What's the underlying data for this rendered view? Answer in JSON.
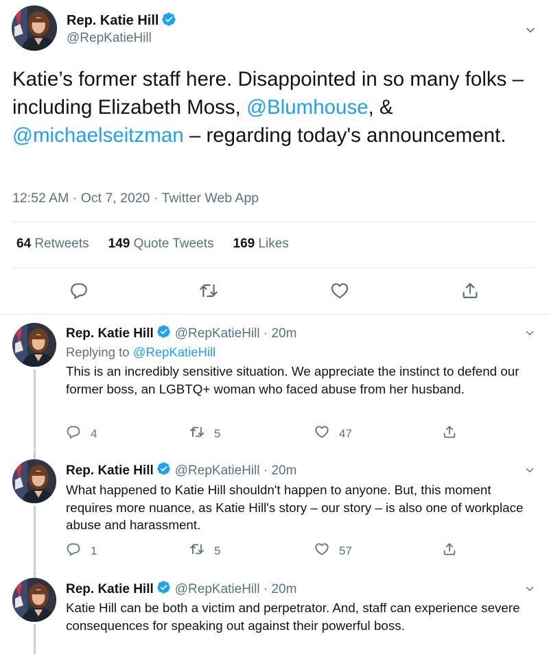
{
  "main_tweet": {
    "author_name": "Rep. Katie Hill",
    "author_handle": "@RepKatieHill",
    "text_part1": "Katie’s former staff here. Disappointed in so many folks – including Elizabeth Moss, ",
    "mention1": "@Blumhouse",
    "text_part2": ", & ",
    "mention2": "@michaelseitzman",
    "text_part3": " – regarding today's announcement.",
    "timestamp": "12:52 AM · Oct 7, 2020 · Twitter Web App",
    "retweets_count": "64",
    "retweets_label": "Retweets",
    "quotes_count": "149",
    "quotes_label": "Quote Tweets",
    "likes_count": "169",
    "likes_label": "Likes"
  },
  "replies": [
    {
      "author_name": "Rep. Katie Hill",
      "handle_time": "@RepKatieHill · 20m",
      "replying_prefix": "Replying to ",
      "replying_to": "@RepKatieHill",
      "text": "This is an incredibly sensitive situation. We appreciate the instinct to defend our former boss, an LGBTQ+ woman who faced abuse from her husband.",
      "reply_count": "4",
      "retweet_count": "5",
      "like_count": "47"
    },
    {
      "author_name": "Rep. Katie Hill",
      "handle_time": "@RepKatieHill · 20m",
      "text": "What happened to Katie Hill shouldn't happen to anyone. But, this moment requires more nuance, as Katie Hill's story  – our story – is also one of workplace abuse and harassment.",
      "reply_count": "1",
      "retweet_count": "5",
      "like_count": "57"
    },
    {
      "author_name": "Rep. Katie Hill",
      "handle_time": "@RepKatieHill · 20m",
      "text": "Katie Hill can be both a victim and perpetrator. And, staff can experience severe consequences for speaking out against their powerful boss."
    }
  ],
  "icons": {
    "verified": "verified-badge-icon",
    "reply": "reply-icon",
    "retweet": "retweet-icon",
    "like": "heart-icon",
    "share": "share-icon",
    "more": "chevron-down-icon"
  },
  "colors": {
    "accent": "#1da1f2",
    "secondary_text": "#5b7083",
    "divider": "#e1e8ed"
  }
}
